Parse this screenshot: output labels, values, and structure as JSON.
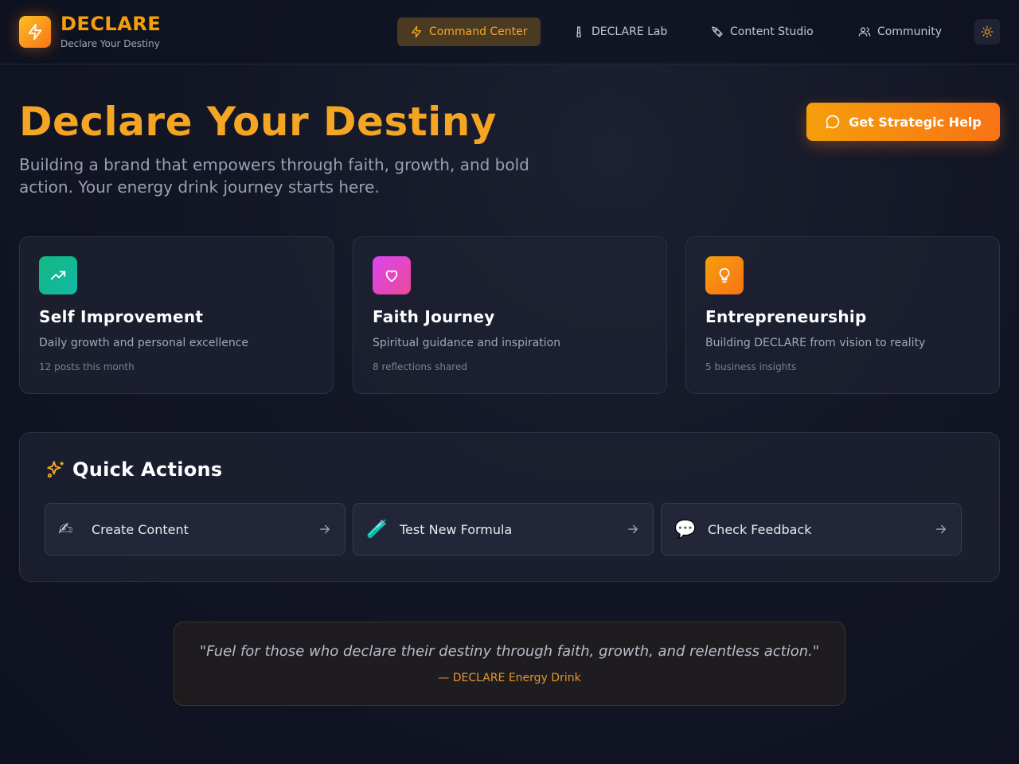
{
  "brand": {
    "name": "DECLARE",
    "tagline": "Declare Your Destiny",
    "logo_icon": "lightning-icon"
  },
  "nav": {
    "items": [
      {
        "label": "Command Center",
        "icon": "lightning-icon",
        "active": true
      },
      {
        "label": "DECLARE Lab",
        "icon": "flask-icon",
        "active": false
      },
      {
        "label": "Content Studio",
        "icon": "pen-tool-icon",
        "active": false
      },
      {
        "label": "Community",
        "icon": "users-icon",
        "active": false
      }
    ],
    "theme_toggle_icon": "sun-icon"
  },
  "hero": {
    "title": "Declare Your Destiny",
    "subtitle": "Building a brand that empowers through faith, growth, and bold action. Your energy drink journey starts here.",
    "cta_label": "Get Strategic Help",
    "cta_icon": "chat-bubble-icon"
  },
  "cards": [
    {
      "title": "Self Improvement",
      "description": "Daily growth and personal excellence",
      "meta": "12 posts this month",
      "icon": "trending-up-icon",
      "color": "#10b981"
    },
    {
      "title": "Faith Journey",
      "description": "Spiritual guidance and inspiration",
      "meta": "8 reflections shared",
      "icon": "heart-icon",
      "color": "#d946ef"
    },
    {
      "title": "Entrepreneurship",
      "description": "Building DECLARE from vision to reality",
      "meta": "5 business insights",
      "icon": "lightbulb-icon",
      "color": "#f97316"
    }
  ],
  "quick_actions": {
    "title": "Quick Actions",
    "icon": "sparkles-icon",
    "items": [
      {
        "label": "Create Content",
        "emoji": "✍",
        "icon": "writing-hand-icon"
      },
      {
        "label": "Test New Formula",
        "emoji": "🧪",
        "icon": "test-tube-icon"
      },
      {
        "label": "Check Feedback",
        "emoji": "💬",
        "icon": "speech-balloon-icon"
      }
    ]
  },
  "quote": {
    "text": "\"Fuel for those who declare their destiny through faith, growth, and relentless action.\"",
    "author": "— DECLARE Energy Drink"
  },
  "colors": {
    "accent": "#f59e0b",
    "accent_dark": "#f97316",
    "background": "#131625"
  }
}
